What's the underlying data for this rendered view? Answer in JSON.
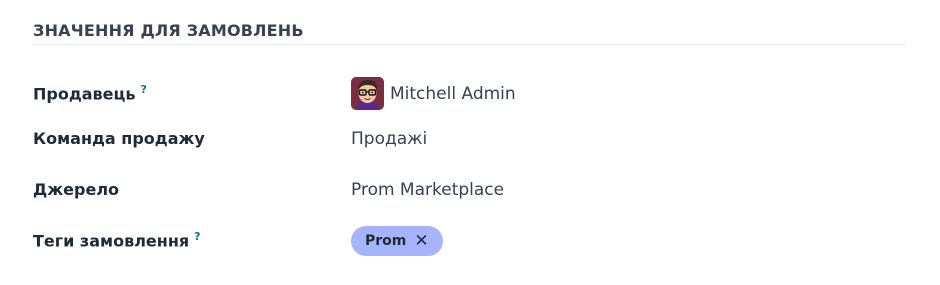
{
  "section": {
    "title": "ЗНАЧЕННЯ ДЛЯ ЗАМОВЛЕНЬ"
  },
  "fields": {
    "salesperson": {
      "label": "Продавець",
      "help": "?",
      "value": "Mitchell Admin",
      "avatar_icon": "user-avatar"
    },
    "sales_team": {
      "label": "Команда продажу",
      "value": "Продажі"
    },
    "source": {
      "label": "Джерело",
      "value": "Prom Marketplace"
    },
    "order_tags": {
      "label": "Теги замовлення",
      "help": "?",
      "tags": [
        {
          "label": "Prom",
          "remove_icon": "close-icon",
          "remove_glyph": "✕",
          "color": "#a5b4fc"
        }
      ]
    }
  },
  "colors": {
    "help_accent": "#0e7490",
    "tag_background": "#a5b4fc",
    "rule": "#e5e7eb"
  }
}
